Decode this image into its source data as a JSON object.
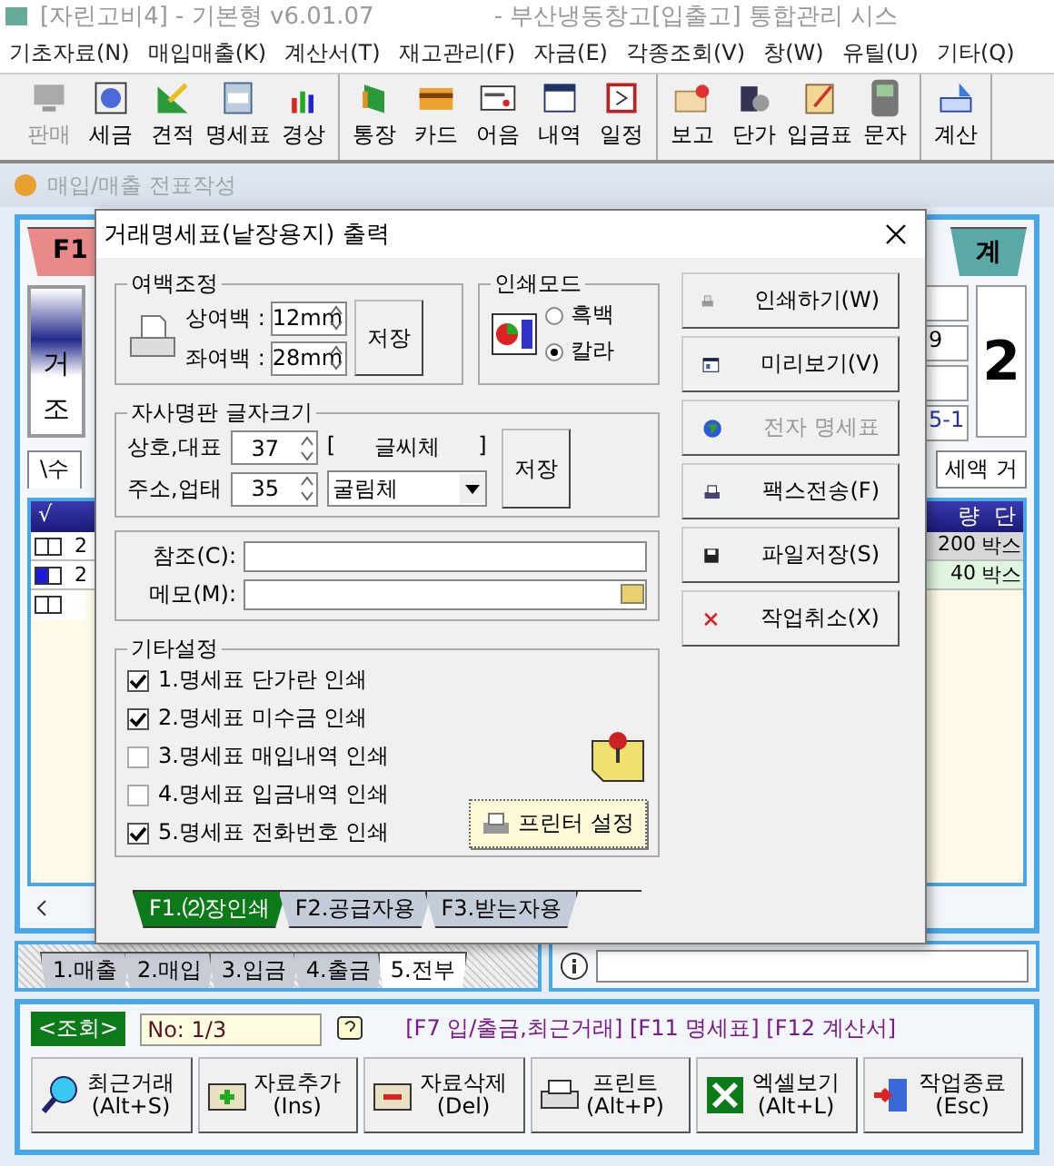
{
  "app": {
    "title": "[자린고비4] - 기본형 v6.01.07",
    "subtitle": "- 부산냉동창고[입출고] 통합관리 시스"
  },
  "menu": [
    "기초자료(N)",
    "매입매출(K)",
    "계산서(T)",
    "재고관리(F)",
    "자금(E)",
    "각종조회(V)",
    "창(W)",
    "유틸(U)",
    "기타(Q)"
  ],
  "toolbar": [
    {
      "items": [
        {
          "label": "판매",
          "disabled": true
        },
        {
          "label": "세금",
          "disabled": false
        },
        {
          "label": "견적",
          "disabled": false
        },
        {
          "label": "명세표",
          "disabled": false
        },
        {
          "label": "경상",
          "disabled": false
        }
      ]
    },
    {
      "items": [
        {
          "label": "통장",
          "disabled": false
        },
        {
          "label": "카드",
          "disabled": false
        },
        {
          "label": "어음",
          "disabled": false
        },
        {
          "label": "내역",
          "disabled": false
        },
        {
          "label": "일정",
          "disabled": false
        }
      ]
    },
    {
      "items": [
        {
          "label": "보고",
          "disabled": false
        },
        {
          "label": "단가",
          "disabled": false
        },
        {
          "label": "입금표",
          "disabled": false
        },
        {
          "label": "문자",
          "disabled": false
        }
      ]
    },
    {
      "items": [
        {
          "label": "계산",
          "disabled": false
        }
      ]
    }
  ],
  "child_window": {
    "title": "매입/매출 전표작성"
  },
  "background": {
    "tab_left": "F1",
    "tab_right": "계",
    "labels": [
      "거",
      "조"
    ],
    "right_values": [
      "9",
      "5-1"
    ],
    "big_digit": "2",
    "sub_tab": "\\수",
    "field": "세액 거",
    "grid": {
      "columns": [
        "√",
        "량",
        "단"
      ],
      "rows": [
        {
          "no": "2",
          "qty": "200",
          "unit": "박스",
          "selected": false
        },
        {
          "no": "2",
          "qty": "40",
          "unit": "박스",
          "selected": true
        }
      ]
    }
  },
  "dialog": {
    "title": "거래명세표(낱장용지) 출력",
    "margins": {
      "title": "여백조정",
      "fields": [
        {
          "label": "상여백 :",
          "value": "12mm"
        },
        {
          "label": "좌여백 :",
          "value": "28mm"
        }
      ],
      "save": "저장"
    },
    "print_mode": {
      "title": "인쇄모드",
      "options": [
        {
          "label": "흑백",
          "selected": false
        },
        {
          "label": "칼라",
          "selected": true
        }
      ]
    },
    "font_size": {
      "title": "자사명판 글자크기",
      "fields": [
        {
          "label": "상호,대표",
          "value": "37"
        },
        {
          "label": "주소,업태",
          "value": "35"
        }
      ],
      "font_label": [
        "[",
        "글씨체",
        "]"
      ],
      "font": "굴림체",
      "save": "저장"
    },
    "notes": [
      {
        "label": "참조(C):"
      },
      {
        "label": "메모(M):"
      }
    ],
    "other": {
      "title": "기타설정",
      "options": [
        {
          "label": "1.명세표 단가란 인쇄",
          "checked": true
        },
        {
          "label": "2.명세표 미수금 인쇄",
          "checked": true
        },
        {
          "label": "3.명세표 매입내역 인쇄",
          "checked": false
        },
        {
          "label": "4.명세표 입금내역 인쇄",
          "checked": false
        },
        {
          "label": "5.명세표 전화번호 인쇄",
          "checked": true
        }
      ],
      "printer_button": "프린터 설정"
    },
    "actions": [
      {
        "label": "인쇄하기(W)",
        "disabled": false
      },
      {
        "label": "미리보기(V)",
        "disabled": false
      },
      {
        "label": "전자 명세표",
        "disabled": true
      },
      {
        "label": "팩스전송(F)",
        "disabled": false
      },
      {
        "label": "파일저장(S)",
        "disabled": false
      },
      {
        "label": "작업취소(X)",
        "disabled": false
      }
    ],
    "tabs": [
      {
        "label": "F1.⑵장인쇄",
        "selected": true
      },
      {
        "label": "F2.공급자용",
        "selected": false
      },
      {
        "label": "F3.받는자용",
        "selected": false
      }
    ]
  },
  "bottom": {
    "tabs": [
      {
        "label": "1.매출",
        "selected": false
      },
      {
        "label": "2.매입",
        "selected": false
      },
      {
        "label": "3.입금",
        "selected": false
      },
      {
        "label": "4.출금",
        "selected": false
      },
      {
        "label": "5.전부",
        "selected": true
      }
    ],
    "mode": "<조회>",
    "record": "No: 1/3",
    "hotkeys": "[F7 입/출금,최근거래] [F11 명세표] [F12 계산서]",
    "buttons": [
      {
        "label": "최근거래",
        "key": "(Alt+S)"
      },
      {
        "label": "자료추가",
        "key": "(Ins)"
      },
      {
        "label": "자료삭제",
        "key": "(Del)"
      },
      {
        "label": "프린트",
        "key": "(Alt+P)"
      },
      {
        "label": "엑셀보기",
        "key": "(Alt+L)"
      },
      {
        "label": "작업종료",
        "key": "(Esc)"
      }
    ]
  }
}
